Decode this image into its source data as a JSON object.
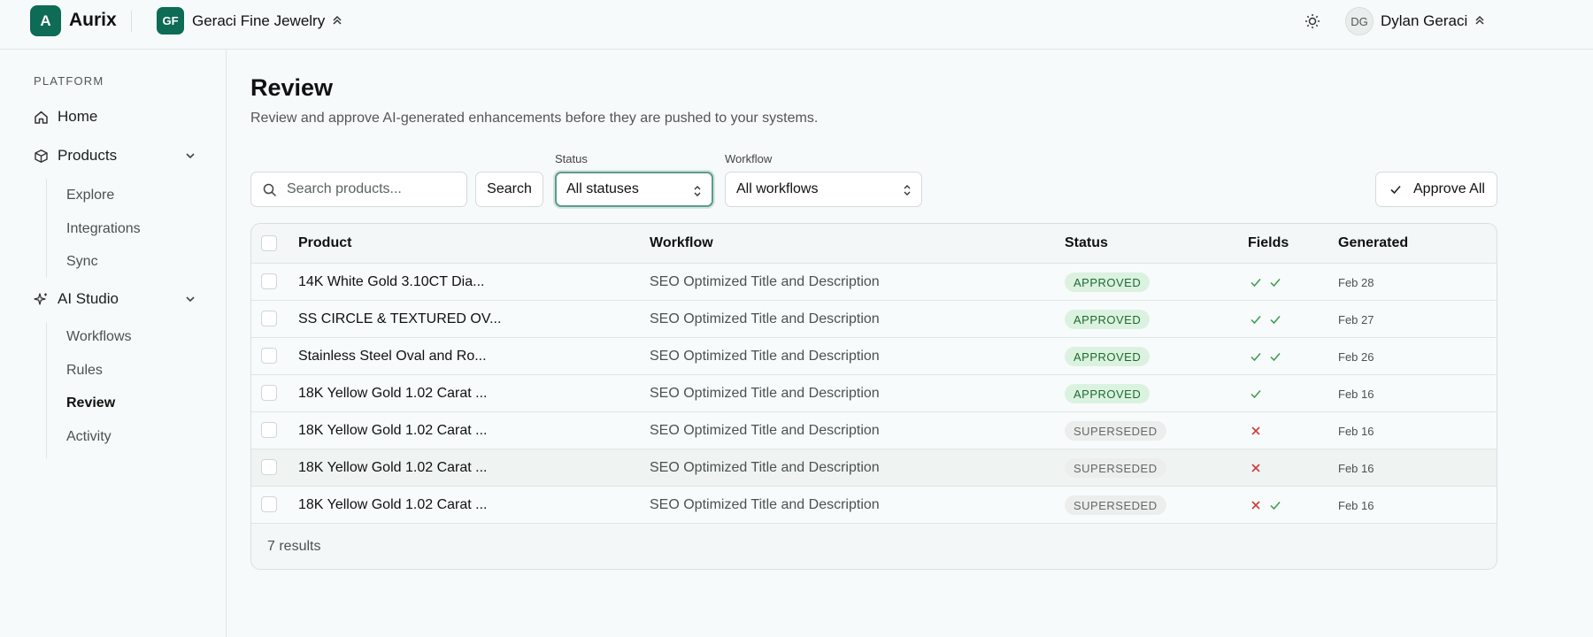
{
  "app": {
    "logo_letter": "A",
    "name": "Aurix"
  },
  "org": {
    "initials": "GF",
    "name": "Geraci Fine Jewelry"
  },
  "user": {
    "initials": "DG",
    "name": "Dylan Geraci"
  },
  "sidebar": {
    "section_label": "PLATFORM",
    "home": "Home",
    "products": {
      "label": "Products",
      "items": [
        "Explore",
        "Integrations",
        "Sync"
      ]
    },
    "ai_studio": {
      "label": "AI Studio",
      "items": [
        "Workflows",
        "Rules",
        "Review",
        "Activity"
      ]
    },
    "active_item": "Review"
  },
  "page": {
    "title": "Review",
    "subtitle": "Review and approve AI-generated enhancements before they are pushed to your systems."
  },
  "toolbar": {
    "search_placeholder": "Search products...",
    "search_button": "Search",
    "status_label": "Status",
    "status_value": "All statuses",
    "workflow_label": "Workflow",
    "workflow_value": "All workflows",
    "approve_all": "Approve All"
  },
  "table": {
    "columns": {
      "product": "Product",
      "workflow": "Workflow",
      "status": "Status",
      "fields": "Fields",
      "generated": "Generated"
    },
    "rows": [
      {
        "product": "14K White Gold 3.10CT Dia...",
        "workflow": "SEO Optimized Title and Description",
        "status": "APPROVED",
        "fields": [
          "check",
          "check"
        ],
        "generated": "Feb 28"
      },
      {
        "product": "SS CIRCLE & TEXTURED OV...",
        "workflow": "SEO Optimized Title and Description",
        "status": "APPROVED",
        "fields": [
          "check",
          "check"
        ],
        "generated": "Feb 27"
      },
      {
        "product": "Stainless Steel Oval and Ro...",
        "workflow": "SEO Optimized Title and Description",
        "status": "APPROVED",
        "fields": [
          "check",
          "check"
        ],
        "generated": "Feb 26"
      },
      {
        "product": "18K Yellow Gold 1.02 Carat ...",
        "workflow": "SEO Optimized Title and Description",
        "status": "APPROVED",
        "fields": [
          "check"
        ],
        "generated": "Feb 16"
      },
      {
        "product": "18K Yellow Gold 1.02 Carat ...",
        "workflow": "SEO Optimized Title and Description",
        "status": "SUPERSEDED",
        "fields": [
          "x"
        ],
        "generated": "Feb 16"
      },
      {
        "product": "18K Yellow Gold 1.02 Carat ...",
        "workflow": "SEO Optimized Title and Description",
        "status": "SUPERSEDED",
        "fields": [
          "x"
        ],
        "generated": "Feb 16"
      },
      {
        "product": "18K Yellow Gold 1.02 Carat ...",
        "workflow": "SEO Optimized Title and Description",
        "status": "SUPERSEDED",
        "fields": [
          "x",
          "check"
        ],
        "generated": "Feb 16"
      }
    ],
    "footer": "7 results"
  },
  "colors": {
    "brand": "#0e6b55",
    "approved_bg": "#dcf2e0",
    "approved_text": "#1e6b2e",
    "check": "#3a9a4e",
    "x": "#d13a3a"
  }
}
